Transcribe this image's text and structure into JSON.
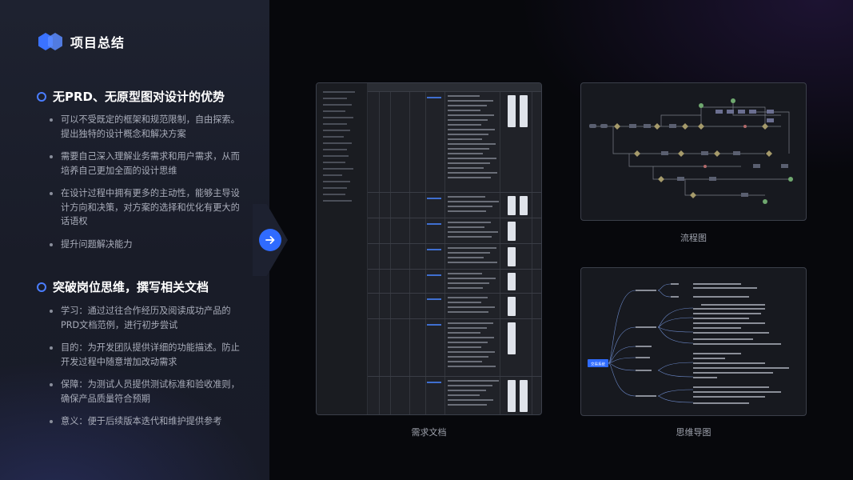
{
  "header": {
    "title": "项目总结"
  },
  "sections": [
    {
      "title": "无PRD、无原型图对设计的优势",
      "bullets": [
        "可以不受既定的框架和规范限制，自由探索。提出独特的设计概念和解决方案",
        "需要自己深入理解业务需求和用户需求，从而培养自己更加全面的设计思维",
        "在设计过程中拥有更多的主动性，能够主导设计方向和决策，对方案的选择和优化有更大的话语权",
        "提升问题解决能力"
      ]
    },
    {
      "title": "突破岗位思维，撰写相关文档",
      "bullets": [
        "学习：通过过往合作经历及阅读成功产品的PRD文档范例，进行初步尝试",
        "目的：为开发团队提供详细的功能描述。防止开发过程中随意增加改动需求",
        "保障：为测试人员提供测试标准和验收准则，确保产品质量符合预期",
        "意义：便于后续版本迭代和维护提供参考"
      ]
    }
  ],
  "captions": {
    "doc": "需求文档",
    "flow": "流程图",
    "mind": "思维导图"
  },
  "mindmap": {
    "root": "交易系统"
  },
  "colors": {
    "accent": "#2f6bff",
    "ring": "#4a7dff",
    "bg_left": "#1e2230"
  },
  "icons": {
    "logo": "hexagon-logo-icon",
    "arrow": "arrow-right-icon"
  }
}
